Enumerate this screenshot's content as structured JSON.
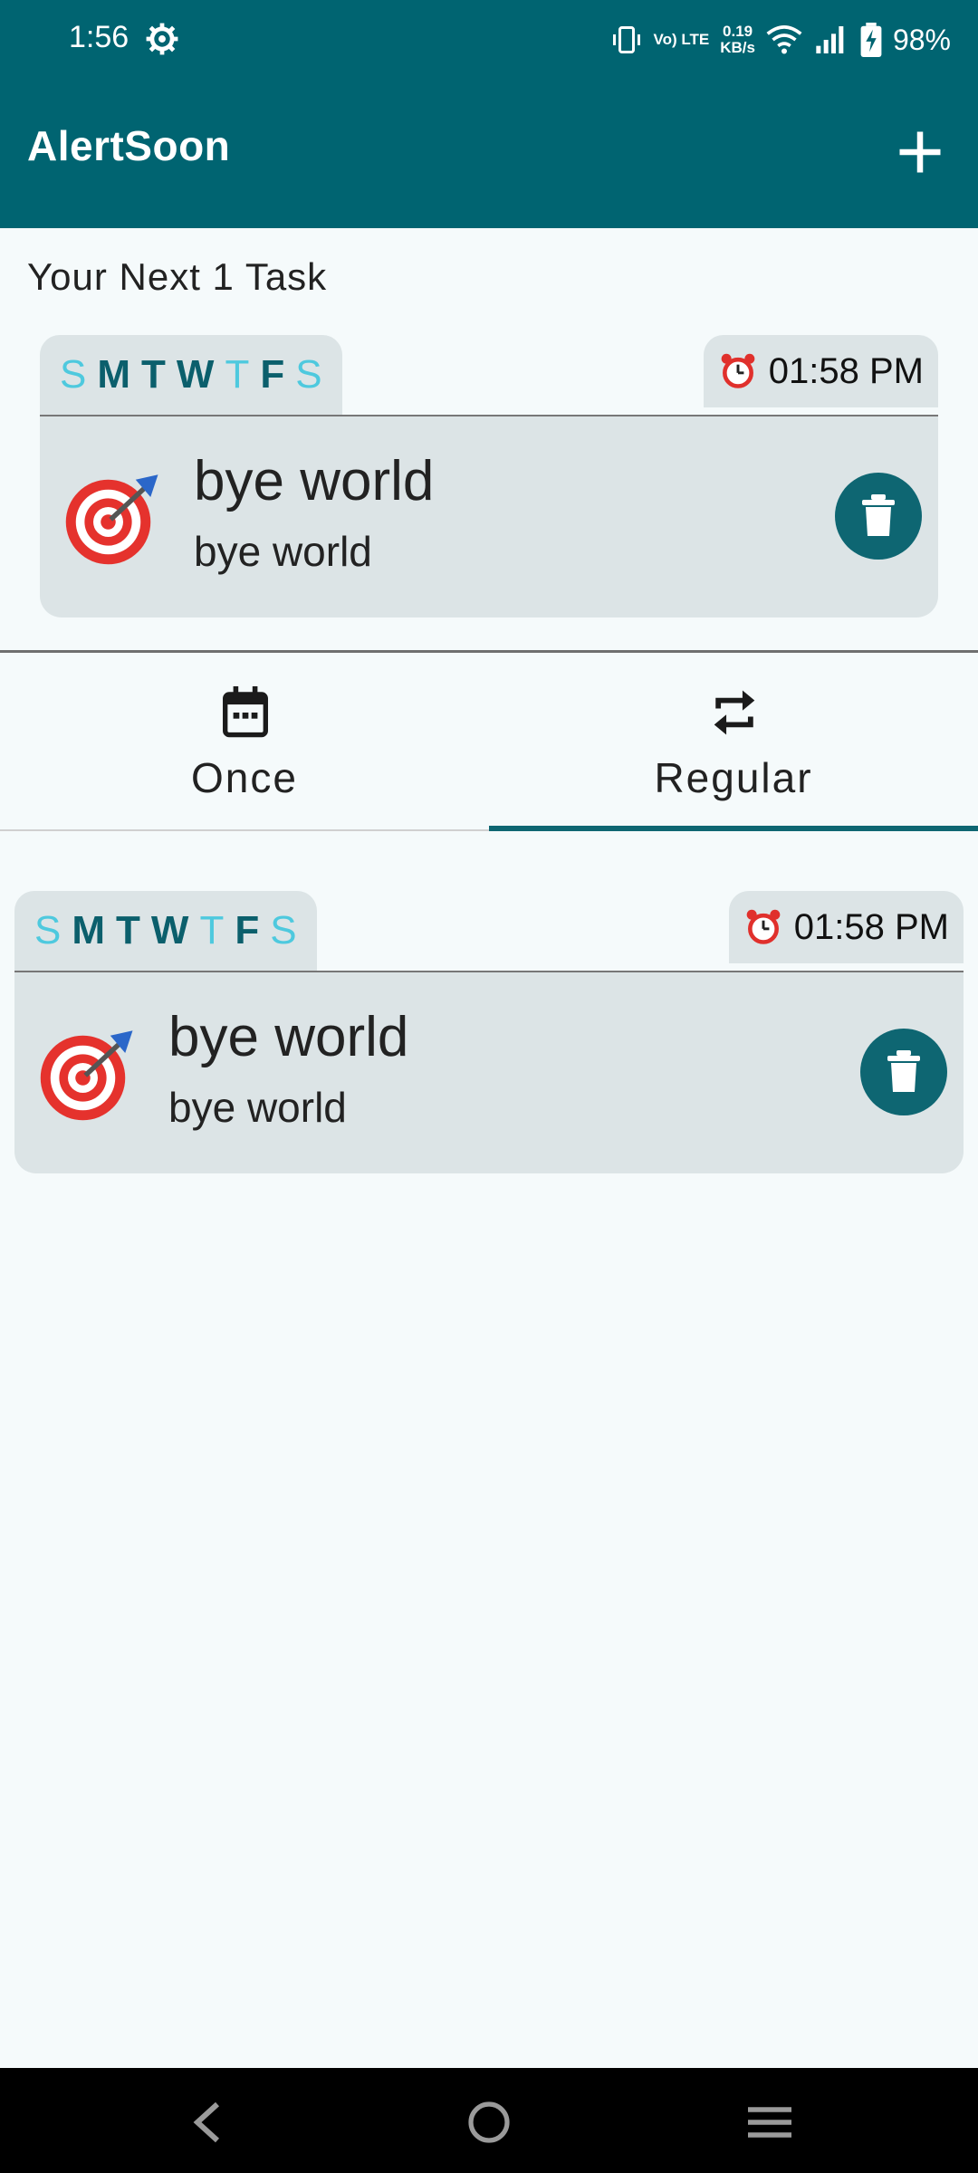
{
  "status_bar": {
    "time": "1:56",
    "network_speed_value": "0.19",
    "network_speed_unit": "KB/s",
    "lte": "Vo) LTE",
    "battery_percent": "98%"
  },
  "app_bar": {
    "title": "AlertSoon",
    "add_icon": "plus-icon"
  },
  "next_tasks": {
    "heading": "Your Next 1 Task",
    "task": {
      "days": [
        {
          "letter": "S",
          "active": false
        },
        {
          "letter": "M",
          "active": true
        },
        {
          "letter": "T",
          "active": true
        },
        {
          "letter": "W",
          "active": true
        },
        {
          "letter": "T",
          "active": false
        },
        {
          "letter": "F",
          "active": true
        },
        {
          "letter": "S",
          "active": false
        }
      ],
      "time": "01:58 PM",
      "title": "bye world",
      "subtitle": "bye world"
    }
  },
  "tabs": [
    {
      "label": "Once",
      "icon": "calendar-icon",
      "selected": false
    },
    {
      "label": "Regular",
      "icon": "repeat-icon",
      "selected": true
    }
  ],
  "regular_tasks": [
    {
      "days": [
        {
          "letter": "S",
          "active": false
        },
        {
          "letter": "M",
          "active": true
        },
        {
          "letter": "T",
          "active": true
        },
        {
          "letter": "W",
          "active": true
        },
        {
          "letter": "T",
          "active": false
        },
        {
          "letter": "F",
          "active": true
        },
        {
          "letter": "S",
          "active": false
        }
      ],
      "time": "01:58 PM",
      "title": "bye world",
      "subtitle": "bye world"
    }
  ],
  "colors": {
    "primary": "#006471",
    "day_active": "#0b5f6c",
    "day_inactive": "#4ec9de",
    "card_bg": "#dce4e6"
  }
}
